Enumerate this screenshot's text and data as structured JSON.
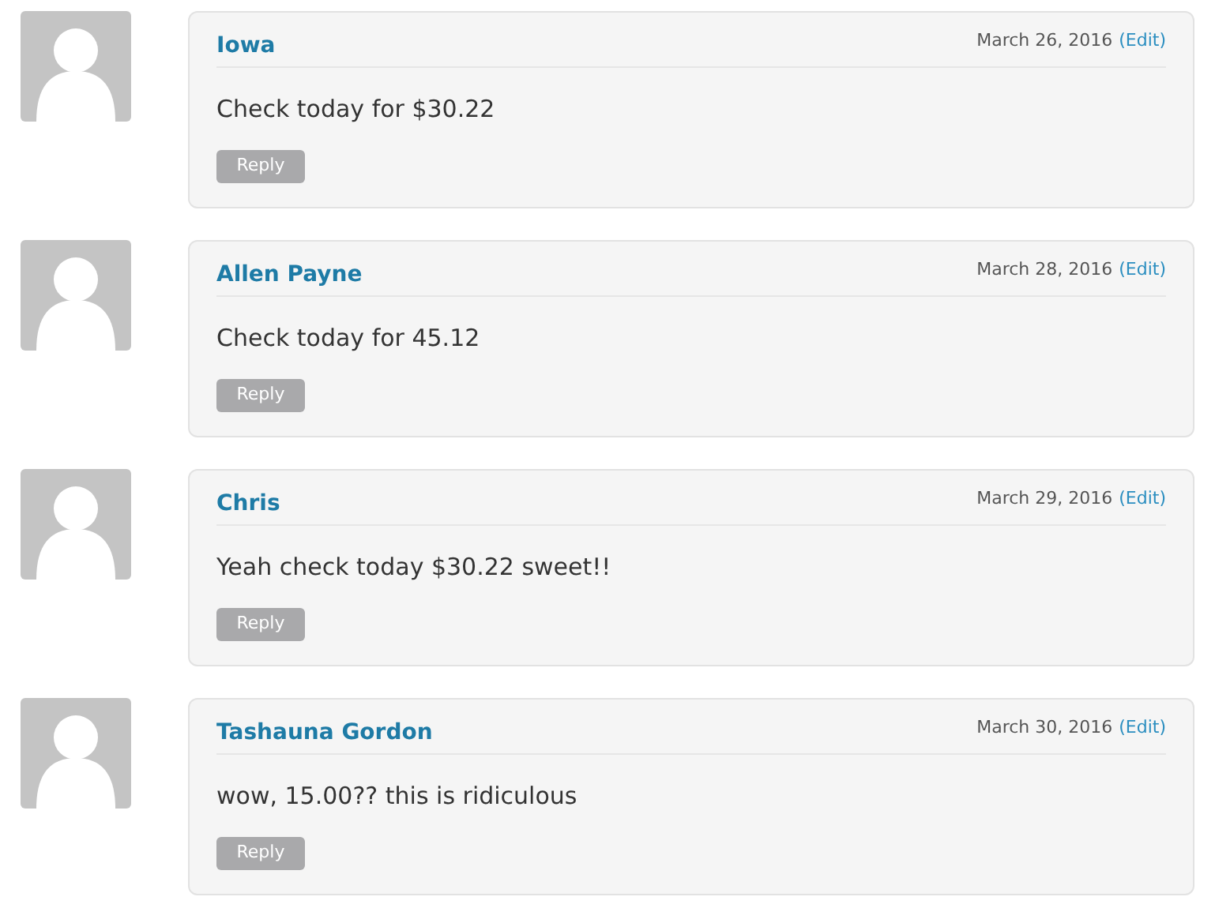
{
  "comments": [
    {
      "author": "Iowa",
      "date": "March 26, 2016",
      "edit": "(Edit)",
      "text": "Check today for $30.22",
      "reply": "Reply"
    },
    {
      "author": "Allen Payne",
      "date": "March 28, 2016",
      "edit": "(Edit)",
      "text": "Check today for 45.12",
      "reply": "Reply"
    },
    {
      "author": "Chris",
      "date": "March 29, 2016",
      "edit": "(Edit)",
      "text": "Yeah check today $30.22 sweet!!",
      "reply": "Reply"
    },
    {
      "author": "Tashauna Gordon",
      "date": "March 30, 2016",
      "edit": "(Edit)",
      "text": "wow, 15.00?? this is ridiculous",
      "reply": "Reply"
    }
  ]
}
